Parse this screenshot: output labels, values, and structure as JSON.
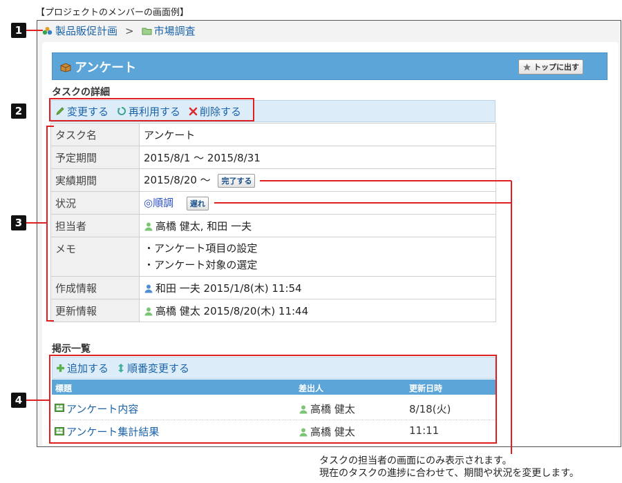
{
  "caption": "【プロジェクトのメンバーの画面例】",
  "breadcrumb": {
    "root": "製品販促計画",
    "sep": ">",
    "current": "市場調査"
  },
  "header": {
    "title": "アンケート",
    "top_button": "トップに出す"
  },
  "task_detail": {
    "section_title": "タスクの詳細",
    "actions": {
      "edit": "変更する",
      "reuse": "再利用する",
      "delete": "削除する"
    },
    "rows": {
      "task_name": {
        "label": "タスク名",
        "value": "アンケート"
      },
      "planned": {
        "label": "予定期間",
        "value": "2015/8/1 ～ 2015/8/31"
      },
      "actual": {
        "label": "実績期間",
        "value": "2015/8/20 ～",
        "button": "完了する"
      },
      "status": {
        "label": "状況",
        "value": "◎順調",
        "button": "遅れ"
      },
      "assignee": {
        "label": "担当者",
        "value": "高橋 健太, 和田 一夫"
      },
      "memo": {
        "label": "メモ",
        "line1": "・アンケート項目の設定",
        "line2": "・アンケート対象の選定"
      },
      "created": {
        "label": "作成情報",
        "value": "和田 一夫 2015/1/8(木) 11:54"
      },
      "updated": {
        "label": "更新情報",
        "value": "高橋 健太 2015/8/20(木) 11:44"
      }
    }
  },
  "board": {
    "section_title": "掲示一覧",
    "actions": {
      "add": "追加する",
      "reorder": "順番変更する"
    },
    "columns": {
      "title": "標題",
      "sender": "差出人",
      "updated": "更新日時"
    },
    "items": [
      {
        "title": "アンケート内容",
        "sender": "高橋 健太",
        "updated": "8/18(火)"
      },
      {
        "title": "アンケート集計結果",
        "sender": "高橋 健太",
        "updated": "11:11"
      }
    ]
  },
  "callouts": {
    "b1": "1",
    "b2": "2",
    "b3": "3",
    "b4": "4",
    "note_line1": "タスクの担当者の画面にのみ表示されます。",
    "note_line2": "現在のタスクの進捗に合わせて、期間や状況を変更します。"
  },
  "colors": {
    "accent": "#5ba5d9",
    "link": "#1b63a8",
    "callout": "#e02020"
  }
}
